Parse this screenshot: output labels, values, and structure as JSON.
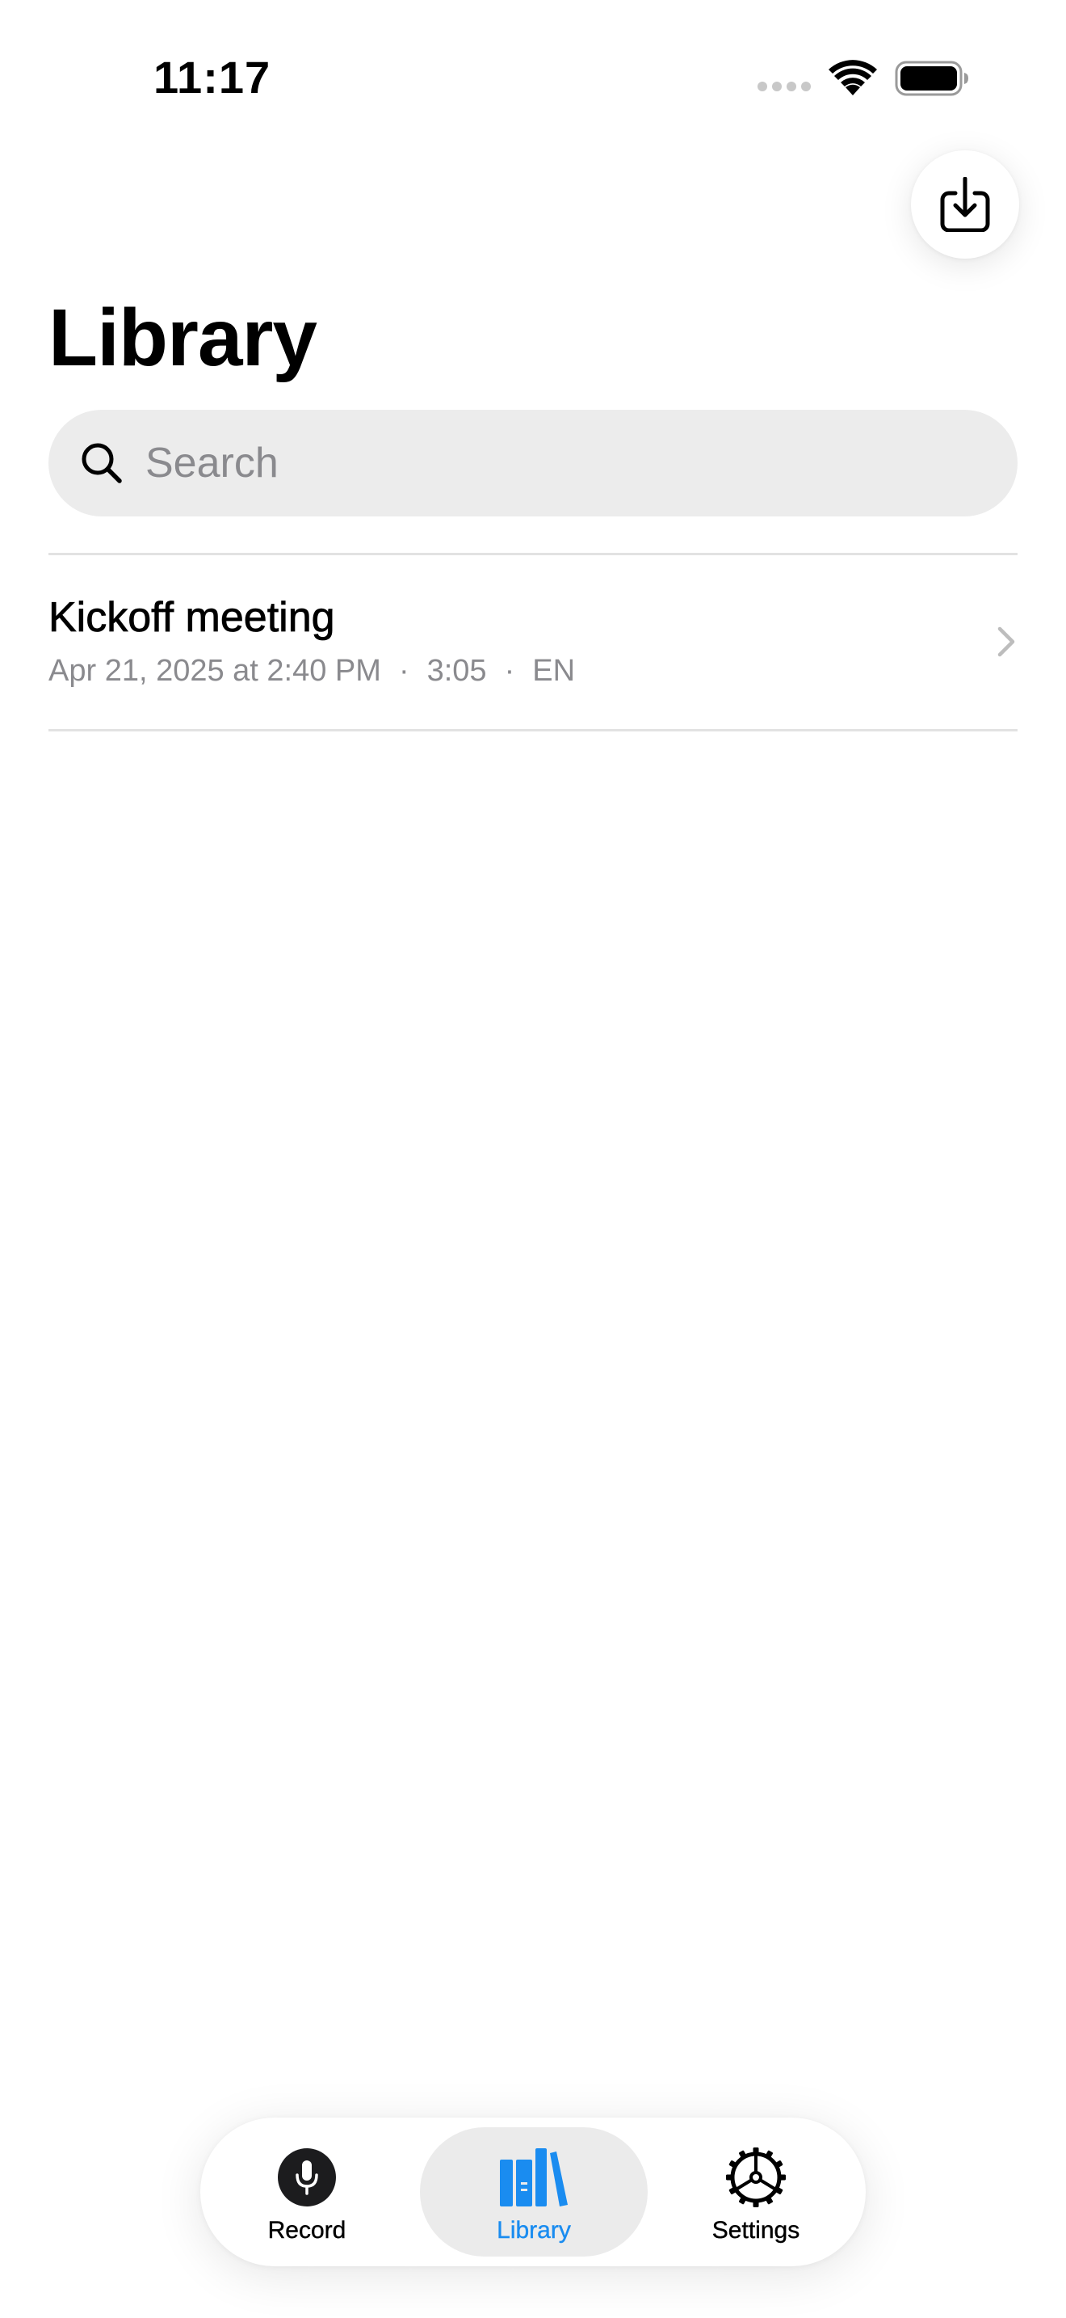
{
  "status_bar": {
    "time": "11:17"
  },
  "header": {
    "title": "Library",
    "import_icon": "tray-arrow-down-icon"
  },
  "search": {
    "placeholder": "Search",
    "value": ""
  },
  "recordings": [
    {
      "title": "Kickoff meeting",
      "date": "Apr 21, 2025 at 2:40 PM",
      "duration": "3:05",
      "language": "EN"
    }
  ],
  "tab_bar": {
    "tabs": [
      {
        "label": "Record",
        "icon": "microphone-icon"
      },
      {
        "label": "Library",
        "icon": "books-icon",
        "selected": true
      },
      {
        "label": "Settings",
        "icon": "gear-icon"
      }
    ]
  },
  "colors": {
    "accent": "#1a8cf0",
    "secondary_text": "#8a8a8e",
    "search_bg": "#ececec"
  }
}
